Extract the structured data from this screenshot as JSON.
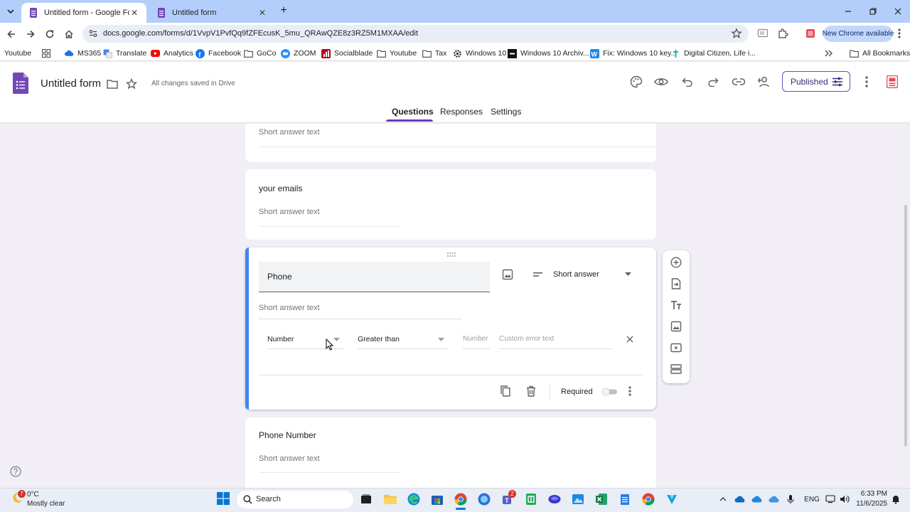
{
  "browser": {
    "tabs": [
      {
        "label": "Untitled form - Google Forms",
        "active": true
      },
      {
        "label": "Untitled form",
        "active": false
      }
    ],
    "url": "docs.google.com/forms/d/1VvpV1PvfQq9fZFEcusK_5mu_QRAwQZE8z3RZ5M1MXAA/edit",
    "new_chrome_label": "New Chrome available"
  },
  "bookmarks": {
    "items": [
      "Youtube",
      "MS365",
      "Translate",
      "Analytics",
      "Facebook",
      "GoCo",
      "ZOOM",
      "Socialblade",
      "Youtube",
      "Tax",
      "Windows 10",
      "Windows 10 Archiv...",
      "Fix: Windows 10 key...",
      "Digital Citizen, Life i..."
    ],
    "all_label": "All Bookmarks"
  },
  "form": {
    "title": "Untitled form",
    "save_status": "All changes saved in Drive",
    "published_label": "Published",
    "tabs": [
      "Questions",
      "Responses",
      "Settings"
    ],
    "accent_color": "#673ab7"
  },
  "questions": {
    "prev_hint": "Short answer text",
    "emails": {
      "title": "your emails",
      "hint": "Short answer text"
    },
    "active": {
      "title": "Phone",
      "hint": "Short answer text",
      "type": "Short answer",
      "validation_type": "Number",
      "validation_condition": "Greater than",
      "number_placeholder": "Number",
      "error_placeholder": "Custom error text",
      "required_label": "Required",
      "required": false
    },
    "phone_number": {
      "title": "Phone Number",
      "hint": "Short answer text"
    }
  },
  "taskbar": {
    "weather_temp": "0°C",
    "weather_desc": "Mostly clear",
    "weather_badge": "7",
    "search_label": "Search",
    "teams_badge": "2",
    "lang": "ENG",
    "time": "6:33 PM",
    "date": "11/6/2025"
  }
}
